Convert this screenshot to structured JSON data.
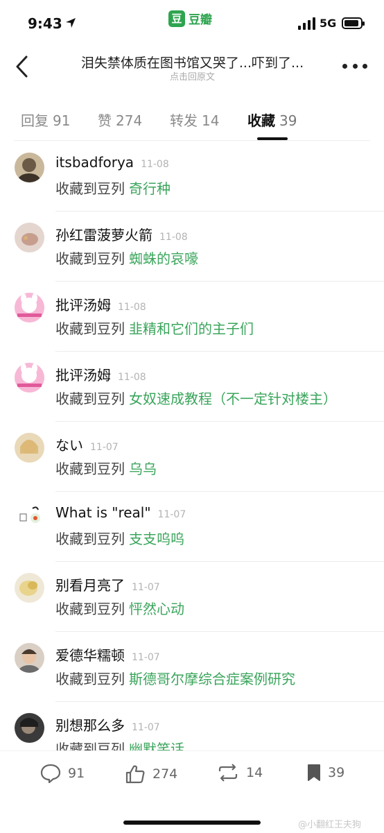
{
  "status_bar": {
    "time": "9:43",
    "network": "5G"
  },
  "app": {
    "icon_char": "豆",
    "name": "豆瓣",
    "accent": "#2ea44f"
  },
  "nav": {
    "title": "泪失禁体质在图书馆又哭了...吓到了...",
    "subtitle": "点击回原文"
  },
  "tabs": [
    {
      "label": "回复",
      "count": "91"
    },
    {
      "label": "赞",
      "count": "274"
    },
    {
      "label": "转发",
      "count": "14"
    },
    {
      "label": "收藏",
      "count": "39"
    }
  ],
  "active_tab": "收藏",
  "items": [
    {
      "name": "itsbadforya",
      "date": "11-08",
      "action": "收藏到豆列",
      "doulist": "奇行种",
      "avatar": "photo-avatar"
    },
    {
      "name": "孙红雷菠萝火箭",
      "date": "11-08",
      "action": "收藏到豆列",
      "doulist": "蜘蛛的哀嚎",
      "avatar": "photo-avatar"
    },
    {
      "name": "批评汤姆",
      "date": "11-08",
      "action": "收藏到豆列",
      "doulist": "韭精和它们的主子们",
      "avatar": "cartoon-avatar"
    },
    {
      "name": "批评汤姆",
      "date": "11-08",
      "action": "收藏到豆列",
      "doulist": "女奴速成教程（不一定针对楼主）",
      "avatar": "cartoon-avatar"
    },
    {
      "name": "ない",
      "date": "11-07",
      "action": "收藏到豆列",
      "doulist": "乌乌",
      "avatar": "photo-avatar"
    },
    {
      "name": "What is \"real\"",
      "date": "11-07",
      "action": "收藏到豆列",
      "doulist": "支支呜呜",
      "avatar": "logo-avatar"
    },
    {
      "name": "别看月亮了",
      "date": "11-07",
      "action": "收藏到豆列",
      "doulist": "怦然心动",
      "avatar": "photo-avatar"
    },
    {
      "name": "爱德华糯顿",
      "date": "11-07",
      "action": "收藏到豆列",
      "doulist": "斯德哥尔摩综合症案例研究",
      "avatar": "photo-avatar"
    },
    {
      "name": "别想那么多",
      "date": "11-07",
      "action": "收藏到豆列",
      "doulist": "幽默笑话",
      "avatar": "photo-avatar"
    }
  ],
  "bottom_bar": {
    "comments": "91",
    "likes": "274",
    "reshares": "14",
    "collects": "39"
  },
  "watermark": "@小翻红王夫狗",
  "colors": {
    "doulist_link": "#3ba55c",
    "date": "#b3b3b3"
  }
}
